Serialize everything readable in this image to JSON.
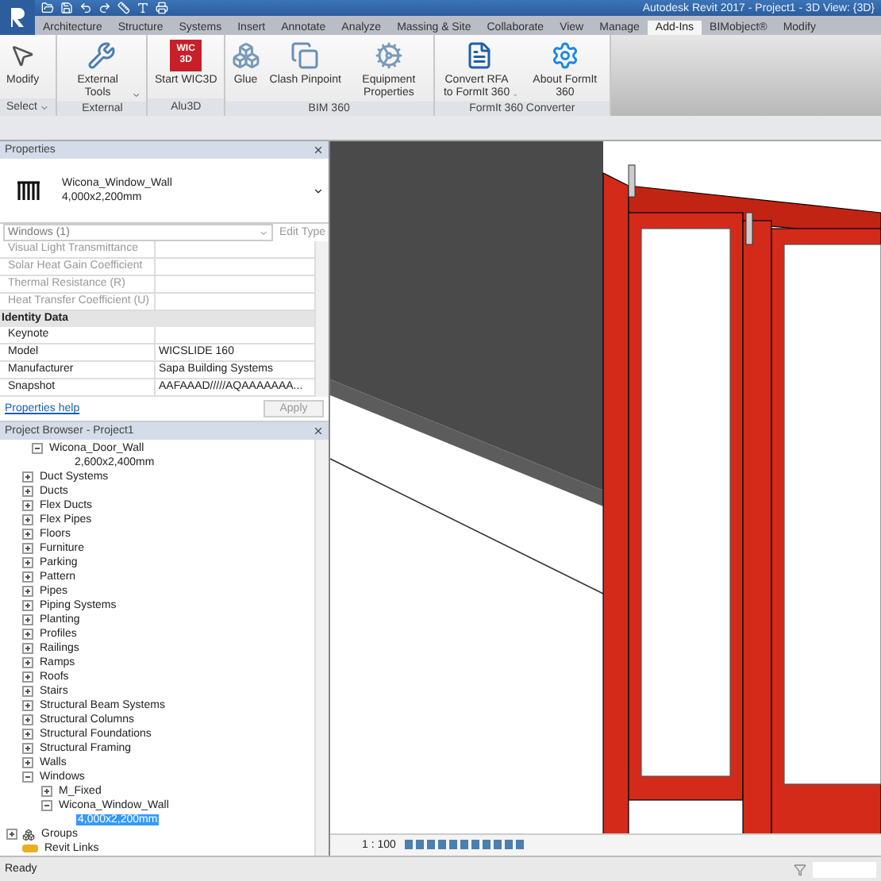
{
  "window": {
    "title": "Autodesk Revit 2017 -   Project1 - 3D View: {3D}"
  },
  "ribbon_tabs": [
    {
      "label": "Architecture",
      "selected": false
    },
    {
      "label": "Structure",
      "selected": false
    },
    {
      "label": "Systems",
      "selected": false
    },
    {
      "label": "Insert",
      "selected": false
    },
    {
      "label": "Annotate",
      "selected": false
    },
    {
      "label": "Analyze",
      "selected": false
    },
    {
      "label": "Massing & Site",
      "selected": false
    },
    {
      "label": "Collaborate",
      "selected": false
    },
    {
      "label": "View",
      "selected": false
    },
    {
      "label": "Manage",
      "selected": false
    },
    {
      "label": "Add-Ins",
      "selected": true
    },
    {
      "label": "BIMobject®",
      "selected": false
    },
    {
      "label": "Modify",
      "selected": false
    }
  ],
  "ribbon_panels": [
    {
      "label": "Select",
      "dropdown": true,
      "tools": [
        {
          "kind": "pointer",
          "label": "Modify",
          "menu": false
        }
      ]
    },
    {
      "label": "External",
      "dropdown": false,
      "tools": [
        {
          "kind": "wrench",
          "label": "External Tools",
          "menu": true
        }
      ]
    },
    {
      "label": "Alu3D",
      "dropdown": false,
      "tools": [
        {
          "kind": "logo",
          "label": "Start WIC3D",
          "logo_text": [
            "WIC",
            "3D"
          ],
          "menu": false
        }
      ]
    },
    {
      "label": "BIM 360",
      "dropdown": false,
      "tools": [
        {
          "kind": "glue",
          "label": "Glue",
          "menu": false
        },
        {
          "kind": "clash",
          "label": "Clash Pinpoint",
          "menu": false
        },
        {
          "kind": "equipment",
          "label": "Equipment Properties",
          "menu": false
        }
      ]
    },
    {
      "label": "FormIt 360 Converter",
      "dropdown": false,
      "tools": [
        {
          "kind": "convert",
          "label": "Convert RFA to FormIt 360",
          "menu": true
        },
        {
          "kind": "formit",
          "label": "About FormIt 360",
          "menu": false
        }
      ]
    }
  ],
  "properties": {
    "title": "Properties",
    "type_name": "Wicona_Window_Wall",
    "type_size": "4,000x2,200mm",
    "selector": "Windows (1)",
    "edit_type": "Edit Type",
    "rows": [
      {
        "kind": "param",
        "name": "Visual Light Transmittance",
        "disabled": true
      },
      {
        "kind": "param",
        "name": "Solar Heat Gain Coefficient",
        "disabled": true
      },
      {
        "kind": "param",
        "name": "Thermal Resistance (R)",
        "disabled": true
      },
      {
        "kind": "param",
        "name": "Heat Transfer Coefficient (U)",
        "disabled": true
      },
      {
        "kind": "group",
        "name": "Identity Data"
      },
      {
        "kind": "param",
        "name": "Keynote",
        "disabled": false
      },
      {
        "kind": "param",
        "name": "Model",
        "value": "WICSLIDE 160",
        "disabled": false
      },
      {
        "kind": "param",
        "name": "Manufacturer",
        "value": "Sapa Building Systems",
        "disabled": false
      },
      {
        "kind": "param",
        "name": "Snapshot",
        "value": "AAFAAAD/////AQAAAAAAA...",
        "disabled": false
      }
    ],
    "help_link": "Properties help",
    "apply": "Apply"
  },
  "project_browser": {
    "title": "Project Browser - Project1",
    "tree": [
      {
        "kind": "family",
        "label": "Wicona_Door_Wall",
        "expanded": true,
        "selected": false,
        "children": [
          {
            "kind": "type",
            "label": "2,600x2,400mm",
            "selected": false
          }
        ]
      },
      {
        "kind": "category",
        "label": "Duct Systems",
        "expanded": false,
        "selected": false
      },
      {
        "kind": "category",
        "label": "Ducts",
        "expanded": false,
        "selected": false
      },
      {
        "kind": "category",
        "label": "Flex Ducts",
        "expanded": false,
        "selected": false
      },
      {
        "kind": "category",
        "label": "Flex Pipes",
        "expanded": false,
        "selected": false
      },
      {
        "kind": "category",
        "label": "Floors",
        "expanded": false,
        "selected": false
      },
      {
        "kind": "category",
        "label": "Furniture",
        "expanded": false,
        "selected": false
      },
      {
        "kind": "category",
        "label": "Parking",
        "expanded": false,
        "selected": false
      },
      {
        "kind": "category",
        "label": "Pattern",
        "expanded": false,
        "selected": false
      },
      {
        "kind": "category",
        "label": "Pipes",
        "expanded": false,
        "selected": false
      },
      {
        "kind": "category",
        "label": "Piping Systems",
        "expanded": false,
        "selected": false
      },
      {
        "kind": "category",
        "label": "Planting",
        "expanded": false,
        "selected": false
      },
      {
        "kind": "category",
        "label": "Profiles",
        "expanded": false,
        "selected": false
      },
      {
        "kind": "category",
        "label": "Railings",
        "expanded": false,
        "selected": false
      },
      {
        "kind": "category",
        "label": "Ramps",
        "expanded": false,
        "selected": false
      },
      {
        "kind": "category",
        "label": "Roofs",
        "expanded": false,
        "selected": false
      },
      {
        "kind": "category",
        "label": "Stairs",
        "expanded": false,
        "selected": false
      },
      {
        "kind": "category",
        "label": "Structural Beam Systems",
        "expanded": false,
        "selected": false
      },
      {
        "kind": "category",
        "label": "Structural Columns",
        "expanded": false,
        "selected": false
      },
      {
        "kind": "category",
        "label": "Structural Foundations",
        "expanded": false,
        "selected": false
      },
      {
        "kind": "category",
        "label": "Structural Framing",
        "expanded": false,
        "selected": false
      },
      {
        "kind": "category",
        "label": "Walls",
        "expanded": false,
        "selected": false
      },
      {
        "kind": "category",
        "label": "Windows",
        "expanded": true,
        "selected": false,
        "children": [
          {
            "kind": "family",
            "label": "M_Fixed",
            "expanded": false,
            "selected": false
          },
          {
            "kind": "family",
            "label": "Wicona_Window_Wall",
            "expanded": true,
            "selected": false,
            "children": [
              {
                "kind": "type",
                "label": "4,000x2,200mm",
                "selected": true
              }
            ]
          }
        ]
      },
      {
        "kind": "groups",
        "label": "Groups",
        "expanded": false,
        "selected": false
      },
      {
        "kind": "links",
        "label": "Revit Links",
        "selected": false
      }
    ]
  },
  "view_control": {
    "scale": "1 : 100"
  },
  "status_bar": {
    "text": "Ready"
  }
}
